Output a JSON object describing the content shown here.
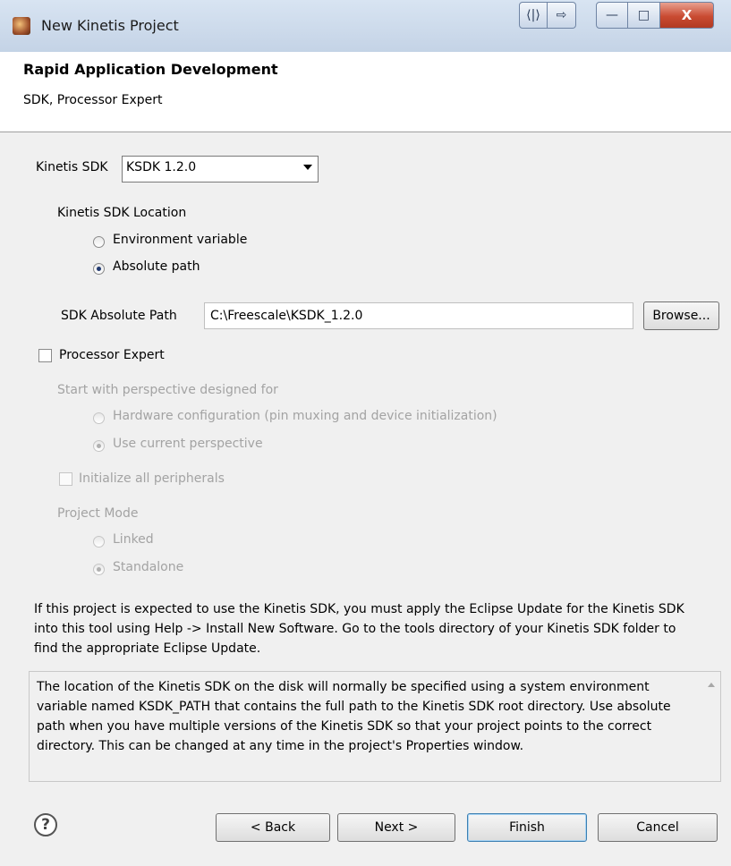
{
  "window": {
    "title": "New Kinetis Project",
    "controls": {
      "restore_glyph": "⟨|⟩",
      "export_glyph": "⇨",
      "minimize_glyph": "—",
      "maximize_glyph": "□",
      "close_glyph": "X"
    }
  },
  "header": {
    "title": "Rapid Application Development",
    "subtitle": "SDK, Processor Expert"
  },
  "sdk": {
    "label": "Kinetis SDK",
    "selected": "KSDK 1.2.0",
    "location_label": "Kinetis SDK Location",
    "option_env": "Environment variable",
    "option_abs": "Absolute path",
    "selected_option": "absolute",
    "path_label": "SDK Absolute Path",
    "path_value": "C:\\Freescale\\KSDK_1.2.0",
    "browse_label": "Browse..."
  },
  "pe": {
    "checkbox_label": "Processor Expert",
    "checked": false,
    "perspective_label": "Start with perspective designed for",
    "option_hw": "Hardware configuration (pin muxing and device initialization)",
    "option_current": "Use current perspective",
    "init_label": "Initialize all peripherals",
    "mode_label": "Project Mode",
    "option_linked": "Linked",
    "option_standalone": "Standalone"
  },
  "info_text": "If this project is expected to use the Kinetis SDK, you must apply the Eclipse Update for the Kinetis SDK into this tool using Help -> Install New Software. Go to the tools directory of your Kinetis SDK folder to find the appropriate Eclipse Update.",
  "description": "The location of the Kinetis SDK on the disk will normally be specified using a system environment variable named KSDK_PATH that contains the full path to the Kinetis SDK root directory. Use absolute path when you have multiple versions of the Kinetis SDK so that your project points to the correct directory. This can be changed at any time in the project's Properties window.",
  "footer": {
    "help_glyph": "?",
    "back_label": "< Back",
    "next_label": "Next >",
    "finish_label": "Finish",
    "cancel_label": "Cancel"
  },
  "colors": {
    "accent": "#3c7fb1",
    "disabled_text": "#a3a3a3"
  }
}
